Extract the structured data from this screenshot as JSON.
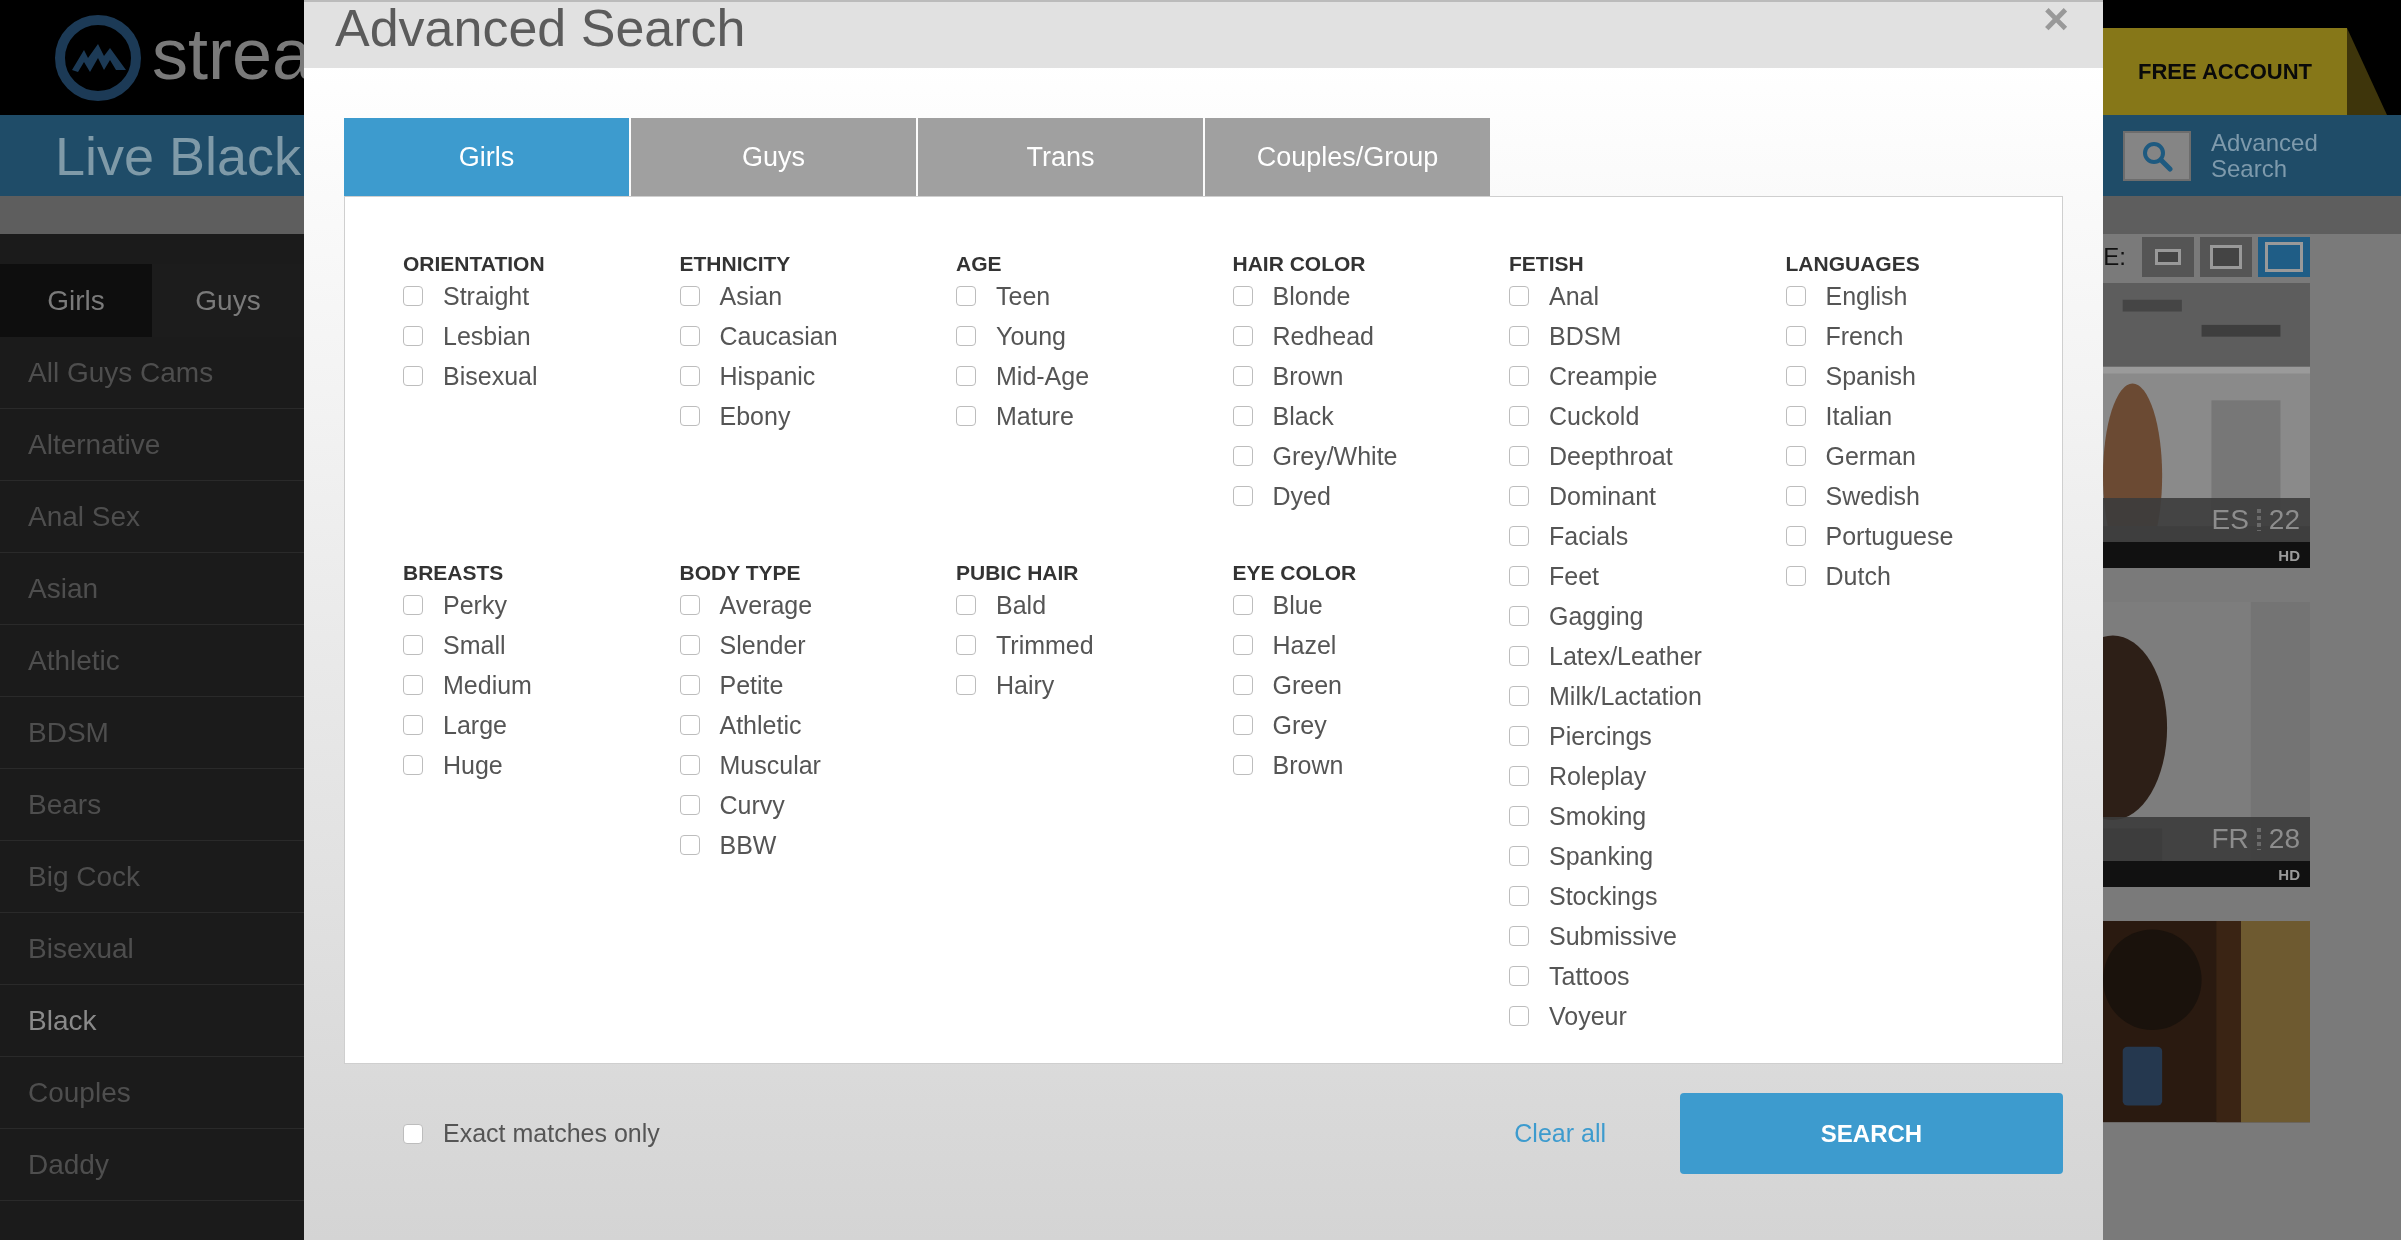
{
  "site": {
    "logo_text": "strea",
    "category_title": "Live Black",
    "free_account": "FREE ACCOUNT",
    "advanced_search_link": "Advanced Search",
    "size_label": "E:",
    "size_options": [
      {
        "selected": false
      },
      {
        "selected": false
      },
      {
        "selected": true
      }
    ]
  },
  "sidebar": {
    "tabs": [
      {
        "label": "Girls",
        "selected": false
      },
      {
        "label": "Guys",
        "selected": true
      }
    ],
    "items": [
      {
        "label": "All Guys Cams",
        "selected": false
      },
      {
        "label": "Alternative",
        "selected": false
      },
      {
        "label": "Anal Sex",
        "selected": false
      },
      {
        "label": "Asian",
        "selected": false
      },
      {
        "label": "Athletic",
        "selected": false
      },
      {
        "label": "BDSM",
        "selected": false
      },
      {
        "label": "Bears",
        "selected": false
      },
      {
        "label": "Big Cock",
        "selected": false
      },
      {
        "label": "Bisexual",
        "selected": false
      },
      {
        "label": "Black",
        "selected": true
      },
      {
        "label": "Couples",
        "selected": false
      },
      {
        "label": "Daddy",
        "selected": false
      }
    ]
  },
  "thumbnails": [
    {
      "kind": "picture",
      "country": "ES",
      "age": "22",
      "badge": "HD"
    },
    {
      "kind": "picture",
      "country": "FR",
      "age": "28",
      "badge": "HD"
    },
    {
      "kind": "picture"
    }
  ],
  "modal": {
    "title": "Advanced Search",
    "close": "×",
    "tabs": [
      {
        "label": "Girls",
        "selected": true
      },
      {
        "label": "Guys",
        "selected": false
      },
      {
        "label": "Trans",
        "selected": false
      },
      {
        "label": "Couples/Group",
        "selected": false
      }
    ],
    "columns": [
      [
        {
          "heading": "ORIENTATION",
          "options": [
            {
              "label": "Straight",
              "checked": false
            },
            {
              "label": "Lesbian",
              "checked": false
            },
            {
              "label": "Bisexual",
              "checked": false
            }
          ]
        },
        {
          "heading": "BREASTS",
          "options": [
            {
              "label": "Perky",
              "checked": false
            },
            {
              "label": "Small",
              "checked": false
            },
            {
              "label": "Medium",
              "checked": false
            },
            {
              "label": "Large",
              "checked": false
            },
            {
              "label": "Huge",
              "checked": false
            }
          ]
        }
      ],
      [
        {
          "heading": "ETHNICITY",
          "options": [
            {
              "label": "Asian",
              "checked": false
            },
            {
              "label": "Caucasian",
              "checked": false
            },
            {
              "label": "Hispanic",
              "checked": false
            },
            {
              "label": "Ebony",
              "checked": false
            }
          ]
        },
        {
          "heading": "BODY TYPE",
          "options": [
            {
              "label": "Average",
              "checked": false
            },
            {
              "label": "Slender",
              "checked": false
            },
            {
              "label": "Petite",
              "checked": false
            },
            {
              "label": "Athletic",
              "checked": false
            },
            {
              "label": "Muscular",
              "checked": false
            },
            {
              "label": "Curvy",
              "checked": false
            },
            {
              "label": "BBW",
              "checked": false
            }
          ]
        }
      ],
      [
        {
          "heading": "AGE",
          "options": [
            {
              "label": "Teen",
              "checked": false
            },
            {
              "label": "Young",
              "checked": false
            },
            {
              "label": "Mid-Age",
              "checked": false
            },
            {
              "label": "Mature",
              "checked": false
            }
          ]
        },
        {
          "heading": "PUBIC HAIR",
          "options": [
            {
              "label": "Bald",
              "checked": false
            },
            {
              "label": "Trimmed",
              "checked": false
            },
            {
              "label": "Hairy",
              "checked": false
            }
          ]
        }
      ],
      [
        {
          "heading": "HAIR COLOR",
          "options": [
            {
              "label": "Blonde",
              "checked": false
            },
            {
              "label": "Redhead",
              "checked": false
            },
            {
              "label": "Brown",
              "checked": false
            },
            {
              "label": "Black",
              "checked": false
            },
            {
              "label": "Grey/White",
              "checked": false
            },
            {
              "label": "Dyed",
              "checked": false
            }
          ]
        },
        {
          "heading": "EYE COLOR",
          "options": [
            {
              "label": "Blue",
              "checked": false
            },
            {
              "label": "Hazel",
              "checked": false
            },
            {
              "label": "Green",
              "checked": false
            },
            {
              "label": "Grey",
              "checked": false
            },
            {
              "label": "Brown",
              "checked": false
            }
          ]
        }
      ],
      [
        {
          "heading": "FETISH",
          "options": [
            {
              "label": "Anal",
              "checked": false
            },
            {
              "label": "BDSM",
              "checked": false
            },
            {
              "label": "Creampie",
              "checked": false
            },
            {
              "label": "Cuckold",
              "checked": false
            },
            {
              "label": "Deepthroat",
              "checked": false
            },
            {
              "label": "Dominant",
              "checked": false
            },
            {
              "label": "Facials",
              "checked": false
            },
            {
              "label": "Feet",
              "checked": false
            },
            {
              "label": "Gagging",
              "checked": false
            },
            {
              "label": "Latex/Leather",
              "checked": false
            },
            {
              "label": "Milk/Lactation",
              "checked": false
            },
            {
              "label": "Piercings",
              "checked": false
            },
            {
              "label": "Roleplay",
              "checked": false
            },
            {
              "label": "Smoking",
              "checked": false
            },
            {
              "label": "Spanking",
              "checked": false
            },
            {
              "label": "Stockings",
              "checked": false
            },
            {
              "label": "Submissive",
              "checked": false
            },
            {
              "label": "Tattoos",
              "checked": false
            },
            {
              "label": "Voyeur",
              "checked": false
            }
          ]
        }
      ],
      [
        {
          "heading": "LANGUAGES",
          "options": [
            {
              "label": "English",
              "checked": false
            },
            {
              "label": "French",
              "checked": false
            },
            {
              "label": "Spanish",
              "checked": false
            },
            {
              "label": "Italian",
              "checked": false
            },
            {
              "label": "German",
              "checked": false
            },
            {
              "label": "Swedish",
              "checked": false
            },
            {
              "label": "Portuguese",
              "checked": false
            },
            {
              "label": "Dutch",
              "checked": false
            }
          ]
        }
      ]
    ],
    "exact_matches": {
      "label": "Exact matches only",
      "checked": false
    },
    "clear_all": "Clear all",
    "search_button": "SEARCH"
  }
}
